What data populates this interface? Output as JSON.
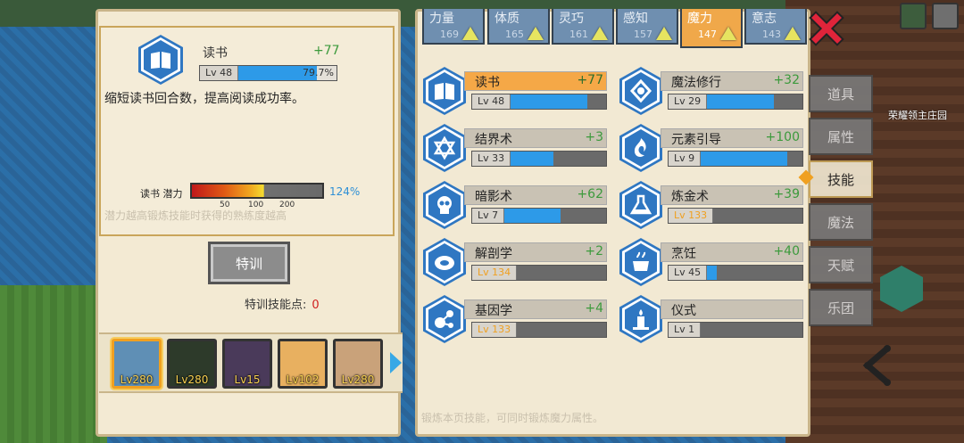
{
  "selected_skill": {
    "name": "读书",
    "bonus": "+77",
    "level": "Lv 48",
    "progress": "79.7%",
    "progress_fraction": 0.797,
    "description": "缩短读书回合数，提高阅读成功率。",
    "potential_label": "读书 潜力",
    "potential_pct": "124%",
    "potential_ticks": [
      "50",
      "100",
      "200"
    ],
    "potential_note": "潜力越高锻炼技能时获得的熟练度越高"
  },
  "train_button": "特训",
  "train_points_label": "特训技能点:",
  "train_points_value": "0",
  "heroes": [
    {
      "level": "Lv280",
      "color": "#5f8fb5"
    },
    {
      "level": "Lv280",
      "color": "#2d3a2a"
    },
    {
      "level": "Lv15",
      "color": "#4a3a5a"
    },
    {
      "level": "Lv102",
      "color": "#e8b060"
    },
    {
      "level": "Lv280",
      "color": "#c9a27a"
    }
  ],
  "stat_tabs": [
    {
      "label": "力量",
      "value": "169"
    },
    {
      "label": "体质",
      "value": "165"
    },
    {
      "label": "灵巧",
      "value": "161"
    },
    {
      "label": "感知",
      "value": "157"
    },
    {
      "label": "魔力",
      "value": "147"
    },
    {
      "label": "意志",
      "value": "143"
    }
  ],
  "skills": [
    {
      "name": "读书",
      "bonus": "+77",
      "level": "Lv 48",
      "fill": 0.797,
      "icon": "book-icon"
    },
    {
      "name": "魔法修行",
      "bonus": "+32",
      "level": "Lv 29",
      "fill": 0.7,
      "icon": "magic-rune-icon"
    },
    {
      "name": "结界术",
      "bonus": "+3",
      "level": "Lv 33",
      "fill": 0.45,
      "icon": "barrier-star-icon"
    },
    {
      "name": "元素引导",
      "bonus": "+100",
      "level": "Lv 9",
      "fill": 0.85,
      "icon": "element-flame-icon"
    },
    {
      "name": "暗影术",
      "bonus": "+62",
      "level": "Lv 7",
      "fill": 0.55,
      "icon": "skull-icon"
    },
    {
      "name": "炼金术",
      "bonus": "+39",
      "level": "Lv 133",
      "fill": 0.0,
      "icon": "flask-icon",
      "max": true
    },
    {
      "name": "解剖学",
      "bonus": "+2",
      "level": "Lv 134",
      "fill": 0.0,
      "icon": "meat-icon",
      "max": true
    },
    {
      "name": "烹饪",
      "bonus": "+40",
      "level": "Lv 45",
      "fill": 0.1,
      "icon": "pot-icon"
    },
    {
      "name": "基因学",
      "bonus": "+4",
      "level": "Lv 133",
      "fill": 0.0,
      "icon": "gene-icon",
      "max": true
    },
    {
      "name": "仪式",
      "bonus": "",
      "level": "Lv 1",
      "fill": 0.0,
      "icon": "candle-icon"
    }
  ],
  "skill_note": "锻炼本页技能，可同时锻炼魔力属性。",
  "side_tabs": [
    "道具",
    "属性",
    "技能",
    "魔法",
    "天赋",
    "乐团"
  ],
  "location": "荣耀领主庄园",
  "colors": {
    "accent": "#f0a84a",
    "hex_blue": "#2f77c2",
    "bar_blue": "#2d9ae8",
    "bonus_green": "#3c9a3c"
  }
}
